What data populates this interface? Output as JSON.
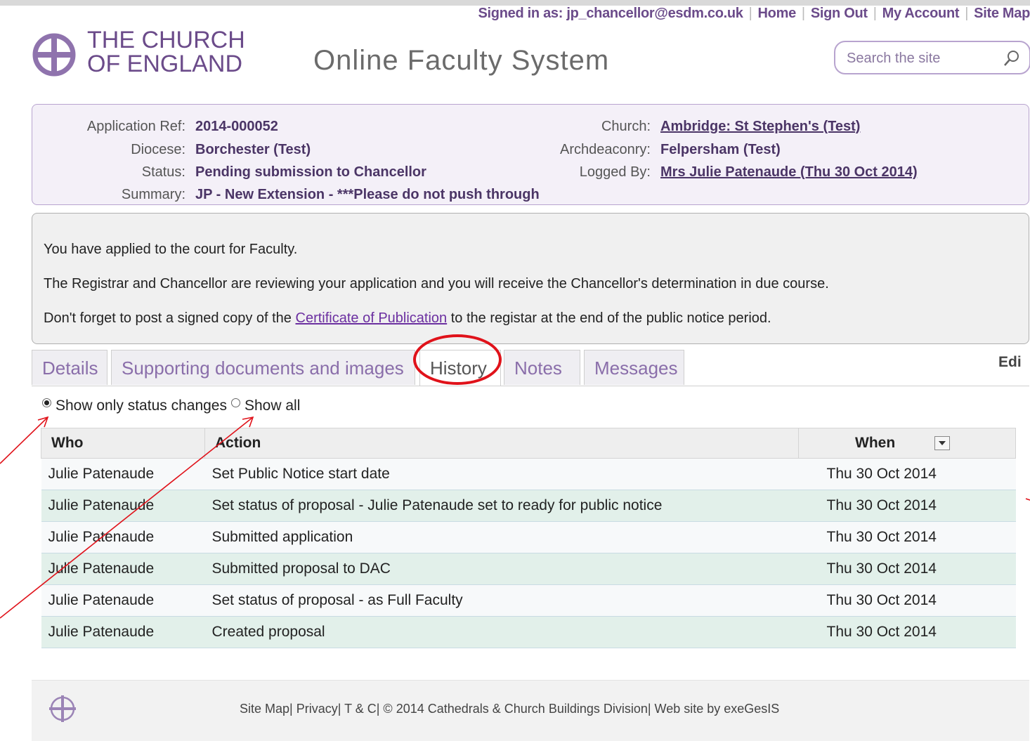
{
  "topnav": {
    "signed_in": "Signed in as: jp_chancellor@esdm.co.uk",
    "home": "Home",
    "sign_out": "Sign Out",
    "my_account": "My Account",
    "site_map": "Site Map"
  },
  "header": {
    "logo_line1": "THE CHURCH",
    "logo_line2": "OF ENGLAND",
    "title": "Online Faculty System",
    "search_placeholder": "Search the site"
  },
  "application": {
    "ref_label": "Application Ref:",
    "ref_value": "2014-000052",
    "diocese_label": "Diocese:",
    "diocese_value": "Borchester (Test)",
    "status_label": "Status:",
    "status_value": "Pending submission to Chancellor",
    "summary_label": "Summary:",
    "summary_value": "JP - New Extension - ***Please do not push through",
    "church_label": "Church:",
    "church_value": "Ambridge: St Stephen's (Test)",
    "archdeaconry_label": "Archdeaconry:",
    "archdeaconry_value": "Felpersham (Test)",
    "logged_label": "Logged By:",
    "logged_value": "Mrs Julie Patenaude (Thu 30 Oct 2014)"
  },
  "message": {
    "line1": "You have applied to the court for Faculty.",
    "line2": "The Registrar and Chancellor are reviewing your application and you will receive the Chancellor's determination in due course.",
    "line3_pre": "Don't forget to post a signed copy of the ",
    "line3_link": "Certificate of Publication",
    "line3_post": " to the registar at the end of the public notice period."
  },
  "tabs": [
    "Details",
    "Supporting documents and images",
    "History",
    "Notes",
    "Messages"
  ],
  "edit_label": "Edi",
  "filters": {
    "status_only": "Show only status changes",
    "show_all": "Show all"
  },
  "history": {
    "columns": [
      "Who",
      "Action",
      "When"
    ],
    "rows": [
      {
        "who": "Julie Patenaude",
        "action": "Set Public Notice start date",
        "when": "Thu 30 Oct 2014"
      },
      {
        "who": "Julie Patenaude",
        "action": "Set status of proposal - Julie Patenaude set to ready for public notice",
        "when": "Thu 30 Oct 2014"
      },
      {
        "who": "Julie Patenaude",
        "action": "Submitted application",
        "when": "Thu 30 Oct 2014"
      },
      {
        "who": "Julie Patenaude",
        "action": "Submitted proposal to DAC",
        "when": "Thu 30 Oct 2014"
      },
      {
        "who": "Julie Patenaude",
        "action": "Set status of proposal - as Full Faculty",
        "when": "Thu 30 Oct 2014"
      },
      {
        "who": "Julie Patenaude",
        "action": "Created proposal",
        "when": "Thu 30 Oct 2014"
      }
    ]
  },
  "footer": {
    "text": "Site Map| Privacy| T & C| © 2014 Cathedrals & Church Buildings Division| Web site by exeGesIS"
  },
  "colors": {
    "brand_purple": "#6b4b8a",
    "annotation_red": "#e0121a",
    "row_alt": "#e2f0ea"
  }
}
